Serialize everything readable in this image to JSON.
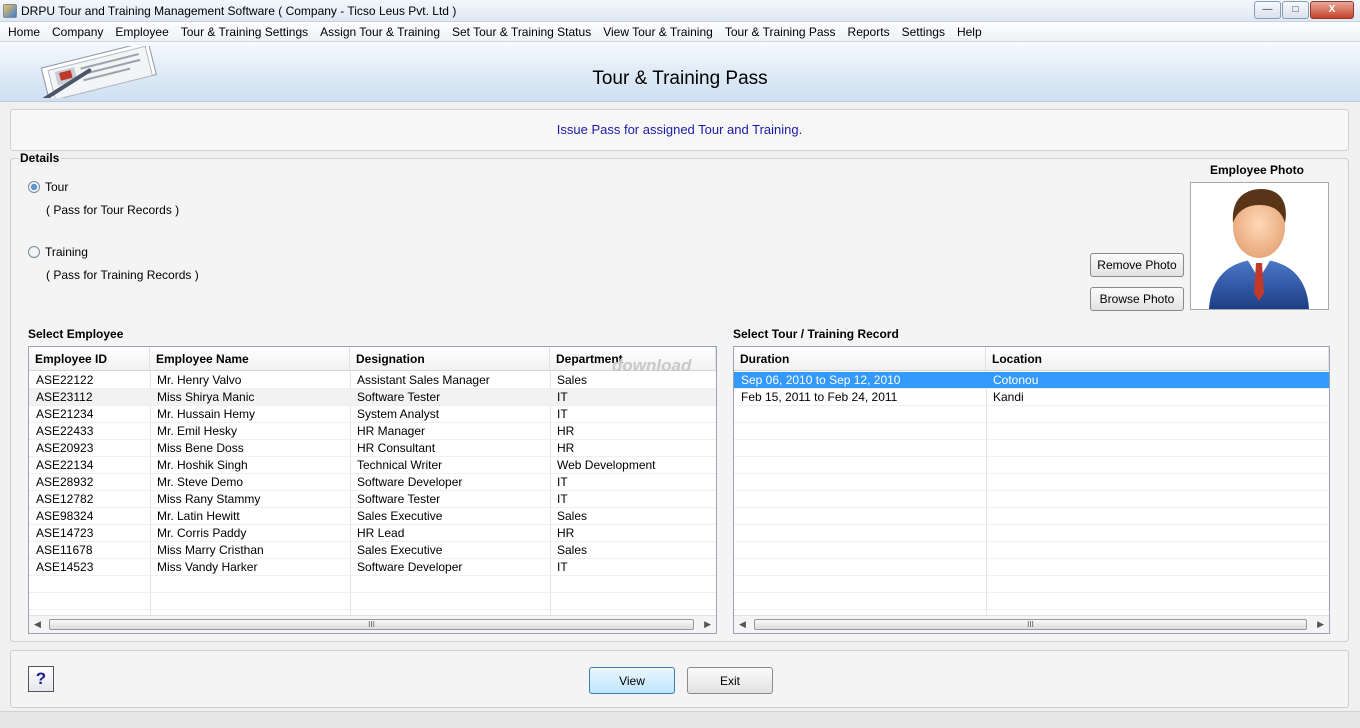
{
  "window": {
    "title": "DRPU Tour and Training Management Software ( Company - Ticso Leus Pvt. Ltd )",
    "min_label": "—",
    "max_label": "□",
    "close_label": "X"
  },
  "menu": [
    "Home",
    "Company",
    "Employee",
    "Tour & Training Settings",
    "Assign Tour & Training",
    "Set Tour & Training Status",
    "View Tour & Training",
    "Tour & Training Pass",
    "Reports",
    "Settings",
    "Help"
  ],
  "header": {
    "title": "Tour & Training Pass"
  },
  "subtitle": "Issue Pass for assigned Tour and Training.",
  "details": {
    "legend": "Details",
    "tour_label": "Tour",
    "tour_note": "( Pass for Tour Records )",
    "training_label": "Training",
    "training_note": "( Pass for Training Records )",
    "selected": "Tour"
  },
  "photo": {
    "label": "Employee Photo",
    "remove_label": "Remove Photo",
    "browse_label": "Browse Photo"
  },
  "employees": {
    "section_label": "Select Employee",
    "columns": [
      "Employee ID",
      "Employee Name",
      "Designation",
      "Department"
    ],
    "rows": [
      [
        "ASE22122",
        "Mr. Henry Valvo",
        "Assistant Sales Manager",
        "Sales"
      ],
      [
        "ASE23112",
        "Miss Shirya Manic",
        "Software Tester",
        "IT"
      ],
      [
        "ASE21234",
        "Mr. Hussain Hemy",
        "System Analyst",
        "IT"
      ],
      [
        "ASE22433",
        "Mr. Emil Hesky",
        "HR Manager",
        "HR"
      ],
      [
        "ASE20923",
        "Miss Bene Doss",
        "HR Consultant",
        "HR"
      ],
      [
        "ASE22134",
        "Mr. Hoshik Singh",
        "Technical Writer",
        "Web Development"
      ],
      [
        "ASE28932",
        "Mr. Steve Demo",
        "Software Developer",
        "IT"
      ],
      [
        "ASE12782",
        "Miss Rany Stammy",
        "Software Tester",
        "IT"
      ],
      [
        "ASE98324",
        "Mr. Latin Hewitt",
        "Sales Executive",
        "Sales"
      ],
      [
        "ASE14723",
        "Mr. Corris Paddy",
        "HR Lead",
        "HR"
      ],
      [
        "ASE11678",
        "Miss Marry Cristhan",
        "Sales Executive",
        "Sales"
      ],
      [
        "ASE14523",
        "Miss Vandy Harker",
        "Software Developer",
        "IT"
      ]
    ],
    "scroll_thumb_label": "III"
  },
  "records": {
    "section_label": "Select Tour / Training Record",
    "columns": [
      "Duration",
      "Location"
    ],
    "rows": [
      [
        "Sep 06, 2010 to Sep 12, 2010",
        "Cotonou"
      ],
      [
        "Feb 15, 2011 to Feb 24, 2011",
        "Kandi"
      ]
    ],
    "selected_index": 0,
    "scroll_thumb_label": "III"
  },
  "watermark": "download",
  "buttons": {
    "view_label": "View",
    "exit_label": "Exit",
    "help_label": "?"
  },
  "colors": {
    "accent": "#3399ff",
    "subtitle": "#1a1aa8"
  }
}
